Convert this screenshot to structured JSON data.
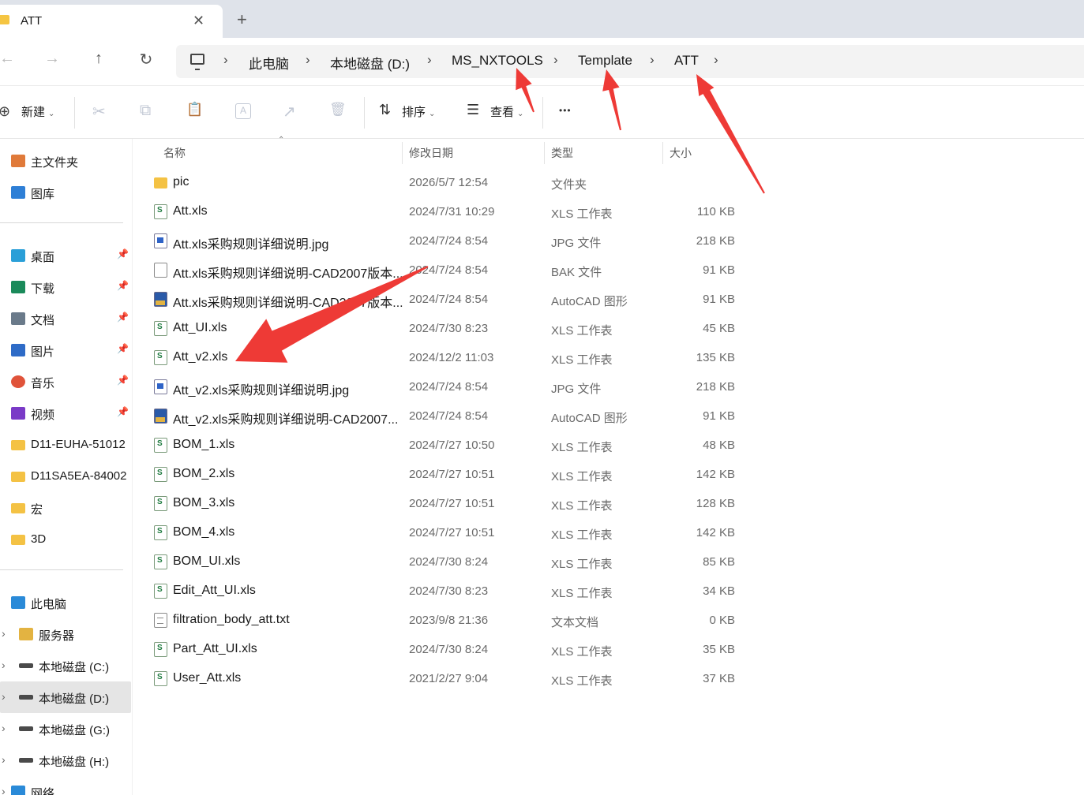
{
  "tab": {
    "title": "ATT",
    "close_icon": "close-icon",
    "new_tab_icon": "plus-icon"
  },
  "nav": {
    "back": "←",
    "forward": "→",
    "up": "↑",
    "refresh": "↻"
  },
  "breadcrumb": {
    "items": [
      "此电脑",
      "本地磁盘 (D:)",
      "MS_NXTOOLS",
      "Template",
      "ATT"
    ],
    "separator": "›"
  },
  "toolbar": {
    "new_label": "新建",
    "sort_label": "排序",
    "view_label": "查看",
    "more_label": "•••",
    "cut_icon": "✂",
    "copy_icon": "⧉",
    "paste_icon": "📋",
    "rename_icon": "A",
    "share_icon": "↗",
    "delete_icon": "🗑"
  },
  "sidebar": {
    "quick": [
      {
        "label": "主文件夹",
        "icon": "home-icon",
        "color": "#e07a3a"
      },
      {
        "label": "图库",
        "icon": "gallery-icon",
        "color": "#2e7fd6"
      }
    ],
    "pinned": [
      {
        "label": "桌面",
        "icon": "desktop-icon",
        "color": "#2a9fd8"
      },
      {
        "label": "下载",
        "icon": "download-icon",
        "color": "#1a8a5a"
      },
      {
        "label": "文档",
        "icon": "documents-icon",
        "color": "#6a7a8a"
      },
      {
        "label": "图片",
        "icon": "pictures-icon",
        "color": "#2e6bc7"
      },
      {
        "label": "音乐",
        "icon": "music-icon",
        "color": "#e0533a"
      },
      {
        "label": "视频",
        "icon": "videos-icon",
        "color": "#7a3ac7"
      }
    ],
    "folders": [
      "D11-EUHA-51012",
      "D11SA5EA-84002",
      "宏",
      "3D"
    ],
    "drives": [
      {
        "label": "此电脑",
        "icon": "pc-icon"
      },
      {
        "label": "服务器",
        "icon": "server-icon"
      },
      {
        "label": "本地磁盘 (C:)",
        "icon": "drive-icon"
      },
      {
        "label": "本地磁盘 (D:)",
        "icon": "drive-icon"
      },
      {
        "label": "本地磁盘 (G:)",
        "icon": "drive-icon"
      },
      {
        "label": "本地磁盘 (H:)",
        "icon": "drive-icon"
      },
      {
        "label": "网络",
        "icon": "network-icon"
      }
    ]
  },
  "columns": {
    "name": "名称",
    "date": "修改日期",
    "type": "类型",
    "size": "大小"
  },
  "files": [
    {
      "name": "pic",
      "date": "2026/5/7 12:54",
      "type": "文件夹",
      "size": "",
      "icon": "folder"
    },
    {
      "name": "Att.xls",
      "date": "2024/7/31 10:29",
      "type": "XLS 工作表",
      "size": "110 KB",
      "icon": "xls"
    },
    {
      "name": "Att.xls采购规则详细说明.jpg",
      "date": "2024/7/24 8:54",
      "type": "JPG 文件",
      "size": "218 KB",
      "icon": "jpg"
    },
    {
      "name": "Att.xls采购规则详细说明-CAD2007版本...",
      "date": "2024/7/24 8:54",
      "type": "BAK 文件",
      "size": "91 KB",
      "icon": "bak"
    },
    {
      "name": "Att.xls采购规则详细说明-CAD2007版本...",
      "date": "2024/7/24 8:54",
      "type": "AutoCAD 图形",
      "size": "91 KB",
      "icon": "dwg"
    },
    {
      "name": "Att_UI.xls",
      "date": "2024/7/30 8:23",
      "type": "XLS 工作表",
      "size": "45 KB",
      "icon": "xls"
    },
    {
      "name": "Att_v2.xls",
      "date": "2024/12/2 11:03",
      "type": "XLS 工作表",
      "size": "135 KB",
      "icon": "xls"
    },
    {
      "name": "Att_v2.xls采购规则详细说明.jpg",
      "date": "2024/7/24 8:54",
      "type": "JPG 文件",
      "size": "218 KB",
      "icon": "jpg"
    },
    {
      "name": "Att_v2.xls采购规则详细说明-CAD2007...",
      "date": "2024/7/24 8:54",
      "type": "AutoCAD 图形",
      "size": "91 KB",
      "icon": "dwg"
    },
    {
      "name": "BOM_1.xls",
      "date": "2024/7/27 10:50",
      "type": "XLS 工作表",
      "size": "48 KB",
      "icon": "xls"
    },
    {
      "name": "BOM_2.xls",
      "date": "2024/7/27 10:51",
      "type": "XLS 工作表",
      "size": "142 KB",
      "icon": "xls"
    },
    {
      "name": "BOM_3.xls",
      "date": "2024/7/27 10:51",
      "type": "XLS 工作表",
      "size": "128 KB",
      "icon": "xls"
    },
    {
      "name": "BOM_4.xls",
      "date": "2024/7/27 10:51",
      "type": "XLS 工作表",
      "size": "142 KB",
      "icon": "xls"
    },
    {
      "name": "BOM_UI.xls",
      "date": "2024/7/30 8:24",
      "type": "XLS 工作表",
      "size": "85 KB",
      "icon": "xls"
    },
    {
      "name": "Edit_Att_UI.xls",
      "date": "2024/7/30 8:23",
      "type": "XLS 工作表",
      "size": "34 KB",
      "icon": "xls"
    },
    {
      "name": "filtration_body_att.txt",
      "date": "2023/9/8 21:36",
      "type": "文本文档",
      "size": "0 KB",
      "icon": "txt"
    },
    {
      "name": "Part_Att_UI.xls",
      "date": "2024/7/30 8:24",
      "type": "XLS 工作表",
      "size": "35 KB",
      "icon": "xls"
    },
    {
      "name": "User_Att.xls",
      "date": "2021/2/27 9:04",
      "type": "XLS 工作表",
      "size": "37 KB",
      "icon": "xls"
    }
  ],
  "annotation_color": "#ee3a36"
}
